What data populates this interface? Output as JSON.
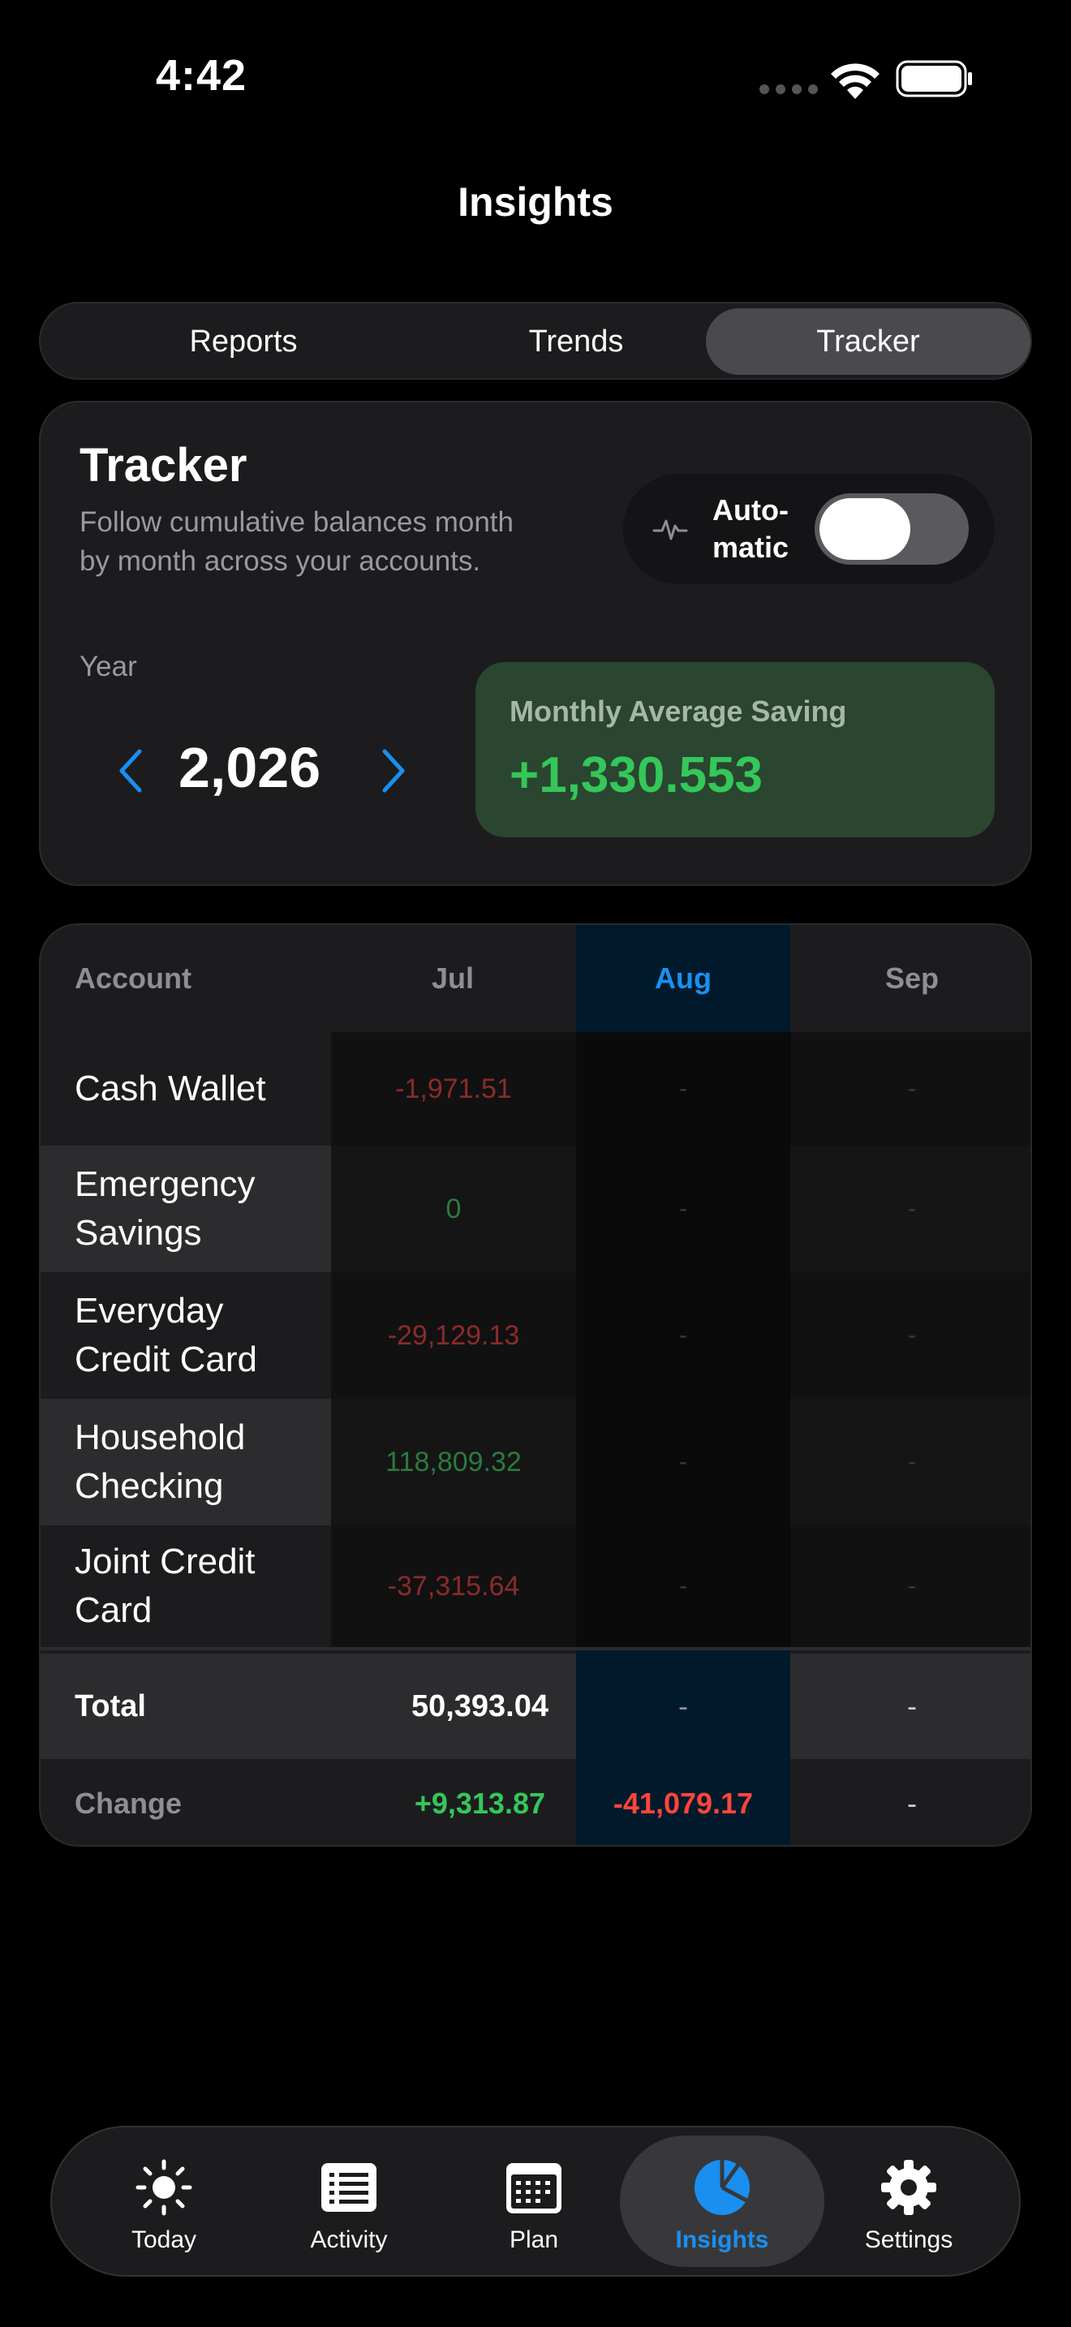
{
  "status": {
    "time": "4:42"
  },
  "header": {
    "title": "Insights"
  },
  "segments": [
    "Reports",
    "Trends",
    "Tracker"
  ],
  "tracker": {
    "title": "Tracker",
    "description": "Follow cumulative balances month by month across your accounts.",
    "auto_label": "Auto-\nmatic",
    "auto_enabled": false,
    "year_label": "Year",
    "year": "2,026",
    "avg_label": "Monthly Average Saving",
    "avg_value": "+1,330.553"
  },
  "table": {
    "headers": [
      "Account",
      "Jul",
      "Aug",
      "Sep"
    ],
    "rows": [
      {
        "name": "Cash Wallet",
        "jul": "-1,971.51",
        "aug": "-",
        "sep": "-"
      },
      {
        "name": "Emergency Savings",
        "jul": "0",
        "aug": "-",
        "sep": "-"
      },
      {
        "name": "Everyday Credit Card",
        "jul": "-29,129.13",
        "aug": "-",
        "sep": "-"
      },
      {
        "name": "Household Checking",
        "jul": "118,809.32",
        "aug": "-",
        "sep": "-"
      },
      {
        "name": "Joint Credit Card",
        "jul": "-37,315.64",
        "aug": "-",
        "sep": "-"
      }
    ],
    "total": {
      "label": "Total",
      "jul": "50,393.04",
      "aug": "-",
      "sep": "-"
    },
    "change": {
      "label": "Change",
      "jul": "+9,313.87",
      "aug": "-41,079.17",
      "sep": "-"
    }
  },
  "tabs": [
    {
      "label": "Today",
      "icon": "sun-icon"
    },
    {
      "label": "Activity",
      "icon": "list-icon"
    },
    {
      "label": "Plan",
      "icon": "calendar-icon"
    },
    {
      "label": "Insights",
      "icon": "pie-chart-icon"
    },
    {
      "label": "Settings",
      "icon": "gear-icon"
    }
  ],
  "colors": {
    "accent": "#1a8ff0",
    "positive": "#34c759",
    "negative": "#ff453a"
  }
}
